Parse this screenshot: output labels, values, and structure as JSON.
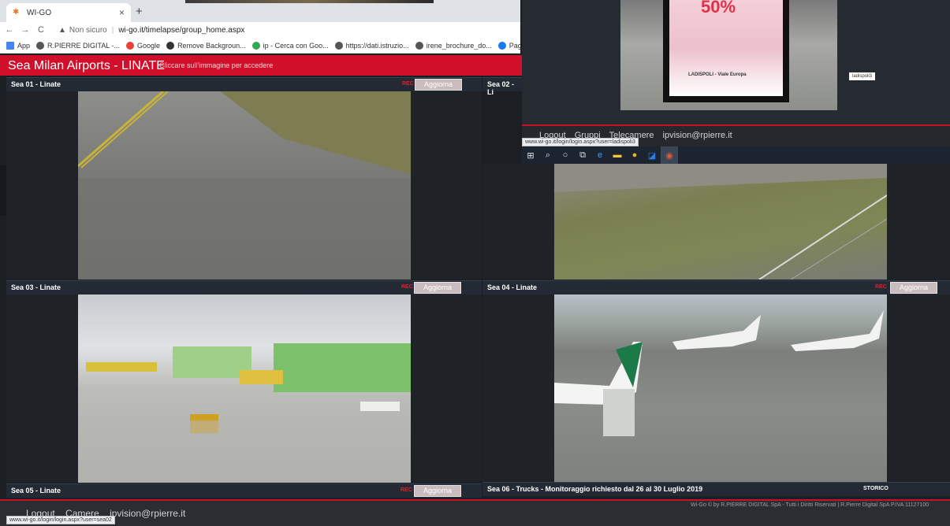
{
  "browser": {
    "tab_title": "WI-GO",
    "tab_close": "×",
    "new_tab": "+",
    "security": "Non sicuro",
    "url": "wi-go.it/timelapse/group_home.aspx",
    "bookmarks": [
      "App",
      "R.PIERRE DIGITAL -...",
      "Google",
      "Remove Backgroun...",
      "ip - Cerca con Goo...",
      "https://dati.istruzio...",
      "irene_brochure_do...",
      "Pagina non trovata..."
    ]
  },
  "site": {
    "title": "Sea Milan Airports - LINATE",
    "hint": "Cliccare sull'immagine per accedere"
  },
  "cameras": [
    {
      "label": "Sea 01 - Linate",
      "rec": "REC",
      "button": "Aggiorna"
    },
    {
      "label": "Sea 02 - Li",
      "rec": "",
      "button": ""
    },
    {
      "label": "Sea 03 - Linate",
      "rec": "REC",
      "button": "Aggiorna"
    },
    {
      "label": "Sea 04 - Linate",
      "rec": "REC",
      "button": "Aggiorna"
    },
    {
      "label": "Sea 05 - Linate",
      "rec": "REC",
      "button": "Aggiorna"
    },
    {
      "label": "Sea 06 - Trucks - Monitoraggio richiesto dal 26 al 30 Luglio 2019",
      "rec": "",
      "button": "",
      "extra": "STORICO"
    }
  ],
  "footer": {
    "logout": "Logout",
    "camere": "Camere",
    "email": "ipvision@rpierre.it",
    "copyright": "Wi-Go © by R.PIERRE DIGITAL SpA - Tutti i Diritti Riservati | R.Pierre Digital SpA P.IVA 11127100",
    "status_url": "www.wi-go.it/login/login.aspx?user=sea02"
  },
  "overlay": {
    "sign_text": "50%",
    "sign_sub": "LADISPOLI - Viale Europa",
    "tag": "ladispoli3",
    "logout": "Logout",
    "gruppi": "Gruppi",
    "telecamere": "Telecamere",
    "email": "ipvision@rpierre.it",
    "status_url": "www.wi-go.it/login/login.aspx?user=ladispoli3"
  }
}
